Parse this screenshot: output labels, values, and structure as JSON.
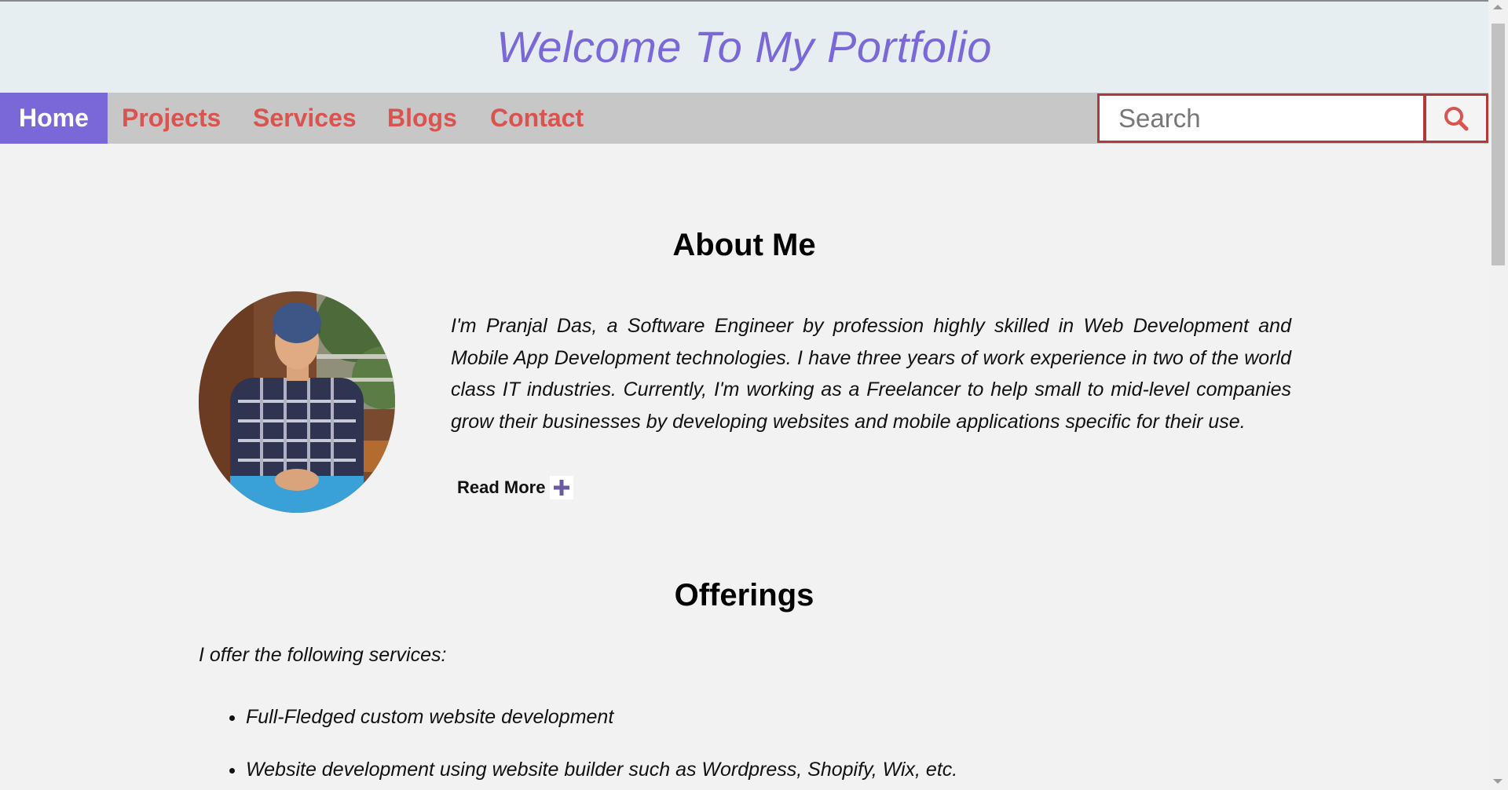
{
  "header": {
    "title": "Welcome To My Portfolio"
  },
  "nav": {
    "items": [
      {
        "label": "Home"
      },
      {
        "label": "Projects"
      },
      {
        "label": "Services"
      },
      {
        "label": "Blogs"
      },
      {
        "label": "Contact"
      }
    ],
    "search_placeholder": "Search",
    "search_icon": "search-icon"
  },
  "about": {
    "heading": "About Me",
    "text": "I'm Pranjal Das, a Software Engineer by profession highly skilled in Web Development and Mobile App Development technologies. I have three years of work experience in two of the world class IT industries. Currently, I'm working as a Freelancer to help small to mid-level companies grow their businesses by developing websites and mobile applications specific for their use.",
    "read_more": "Read More",
    "read_more_icon": "plus-icon"
  },
  "offerings": {
    "heading": "Offerings",
    "intro": "I offer the following services:",
    "items": [
      "Full-Fledged custom website development",
      "Website development using website builder such as Wordpress, Shopify, Wix, etc."
    ]
  },
  "colors": {
    "accent": "#7b68d8",
    "nav_text": "#d9534f",
    "search_border": "#b03a3a",
    "header_bg": "#e7eef2",
    "nav_bg": "#c7c7c7",
    "page_bg": "#f2f2f2"
  }
}
